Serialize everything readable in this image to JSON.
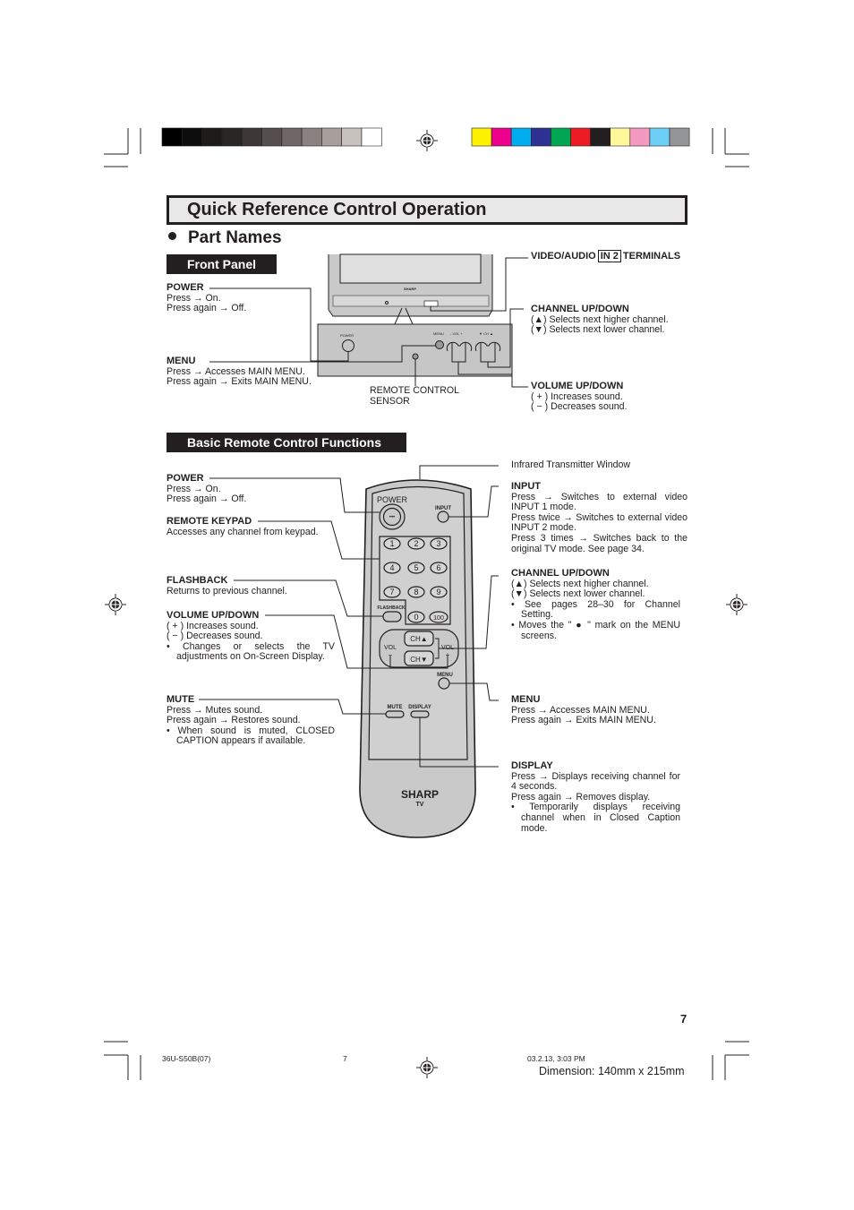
{
  "header": {
    "title": "Quick Reference Control Operation",
    "section": "Part Names",
    "front_panel_label": "Front Panel",
    "remote_label": "Basic Remote Control Functions"
  },
  "color_bars": {
    "grays": [
      "#000000",
      "#0d0d0d",
      "#1e1a1a",
      "#2b2626",
      "#3d3837",
      "#544e4c",
      "#6d6664",
      "#8a8280",
      "#a79f9c",
      "#c8c2bf",
      "#ffffff"
    ],
    "colors": [
      "#fff200",
      "#ec008c",
      "#00aeef",
      "#2e3192",
      "#00a651",
      "#ed1c24",
      "#231f20",
      "#fff799",
      "#f49ac1",
      "#6dcff6",
      "#939598"
    ]
  },
  "front_panel": {
    "power": {
      "title": "POWER",
      "lines": [
        "Press → On.",
        "Press again → Off."
      ]
    },
    "menu": {
      "title": "MENU",
      "lines": [
        "Press → Accesses MAIN MENU.",
        "Press again → Exits MAIN MENU."
      ]
    },
    "sensor": {
      "lines": [
        "REMOTE CONTROL",
        "SENSOR"
      ]
    },
    "video_audio": {
      "before": "VIDEO/AUDIO",
      "boxed": "IN 2",
      "after": "TERMINALS"
    },
    "channel": {
      "title": "CHANNEL UP/DOWN",
      "lines": [
        "(▲)  Selects next higher channel.",
        "(▼)  Selects next lower channel."
      ]
    },
    "volume": {
      "title": "VOLUME UP/DOWN",
      "lines": [
        "( + ) Increases sound.",
        "( − ) Decreases sound."
      ]
    },
    "tv_brand": "SHARP",
    "panel_labels": {
      "power": "POWER",
      "menu": "MENU",
      "vol": "- VOL +",
      "ch": "▼ CH ▲"
    }
  },
  "remote": {
    "power": {
      "title": "POWER",
      "lines": [
        "Press → On.",
        "Press again → Off."
      ]
    },
    "keypad": {
      "title": "REMOTE KEYPAD",
      "lines": [
        "Accesses any channel from keypad."
      ]
    },
    "flashback": {
      "title": "FLASHBACK",
      "lines": [
        "Returns to previous channel."
      ]
    },
    "volume": {
      "title": "VOLUME UP/DOWN",
      "lines": [
        "( + ) Increases sound.",
        "( − ) Decreases sound.",
        "•  Changes or selects the TV",
        "adjustments on On-Screen Display."
      ]
    },
    "mute": {
      "title": "MUTE",
      "lines": [
        "Press → Mutes sound.",
        "Press again → Restores sound.",
        "•  When sound is muted, CLOSED",
        "CAPTION appears if available."
      ]
    },
    "infrared": {
      "lines": [
        "Infrared Transmitter Window"
      ]
    },
    "input": {
      "title": "INPUT",
      "lines": [
        "Press → Switches to external video",
        "INPUT 1 mode.",
        "Press twice → Switches to external video",
        "INPUT 2 mode.",
        "Press 3 times → Switches back to the",
        "original TV mode. See page 34."
      ]
    },
    "channel": {
      "title": "CHANNEL UP/DOWN",
      "lines": [
        "(▲) Selects next higher channel.",
        "(▼) Selects next lower channel.",
        "•  See pages 28–30 for Channel",
        "Setting.",
        "•  Moves the \" ● \" mark on the MENU",
        "screens."
      ]
    },
    "menu": {
      "title": "MENU",
      "lines": [
        "Press → Accesses MAIN MENU.",
        "Press again → Exits MAIN MENU."
      ]
    },
    "display": {
      "title": "DISPLAY",
      "lines": [
        "Press → Displays receiving channel for",
        "4 seconds.",
        "Press again → Removes display.",
        "•  Temporarily displays receiving",
        "channel when in Closed Caption",
        "mode."
      ]
    },
    "buttons": {
      "power": "POWER",
      "input": "INPUT",
      "keys": [
        "1",
        "2",
        "3",
        "4",
        "5",
        "6",
        "7",
        "8",
        "9",
        "0",
        "100"
      ],
      "flashback": "FLASHBACK",
      "ch_up": "CH▲",
      "ch_down": "CH▼",
      "vol": "VOL",
      "vol_minus": "−",
      "vol_plus": "+",
      "menu": "MENU",
      "mute": "MUTE",
      "display": "DISPLAY",
      "brand": "SHARP",
      "brand_sub": "TV"
    }
  },
  "page_number": "7",
  "footer": {
    "code": "36U-S50B(07)",
    "page": "7",
    "date": "03.2.13, 3:03 PM",
    "dimension": "Dimension: 140mm x 215mm"
  }
}
